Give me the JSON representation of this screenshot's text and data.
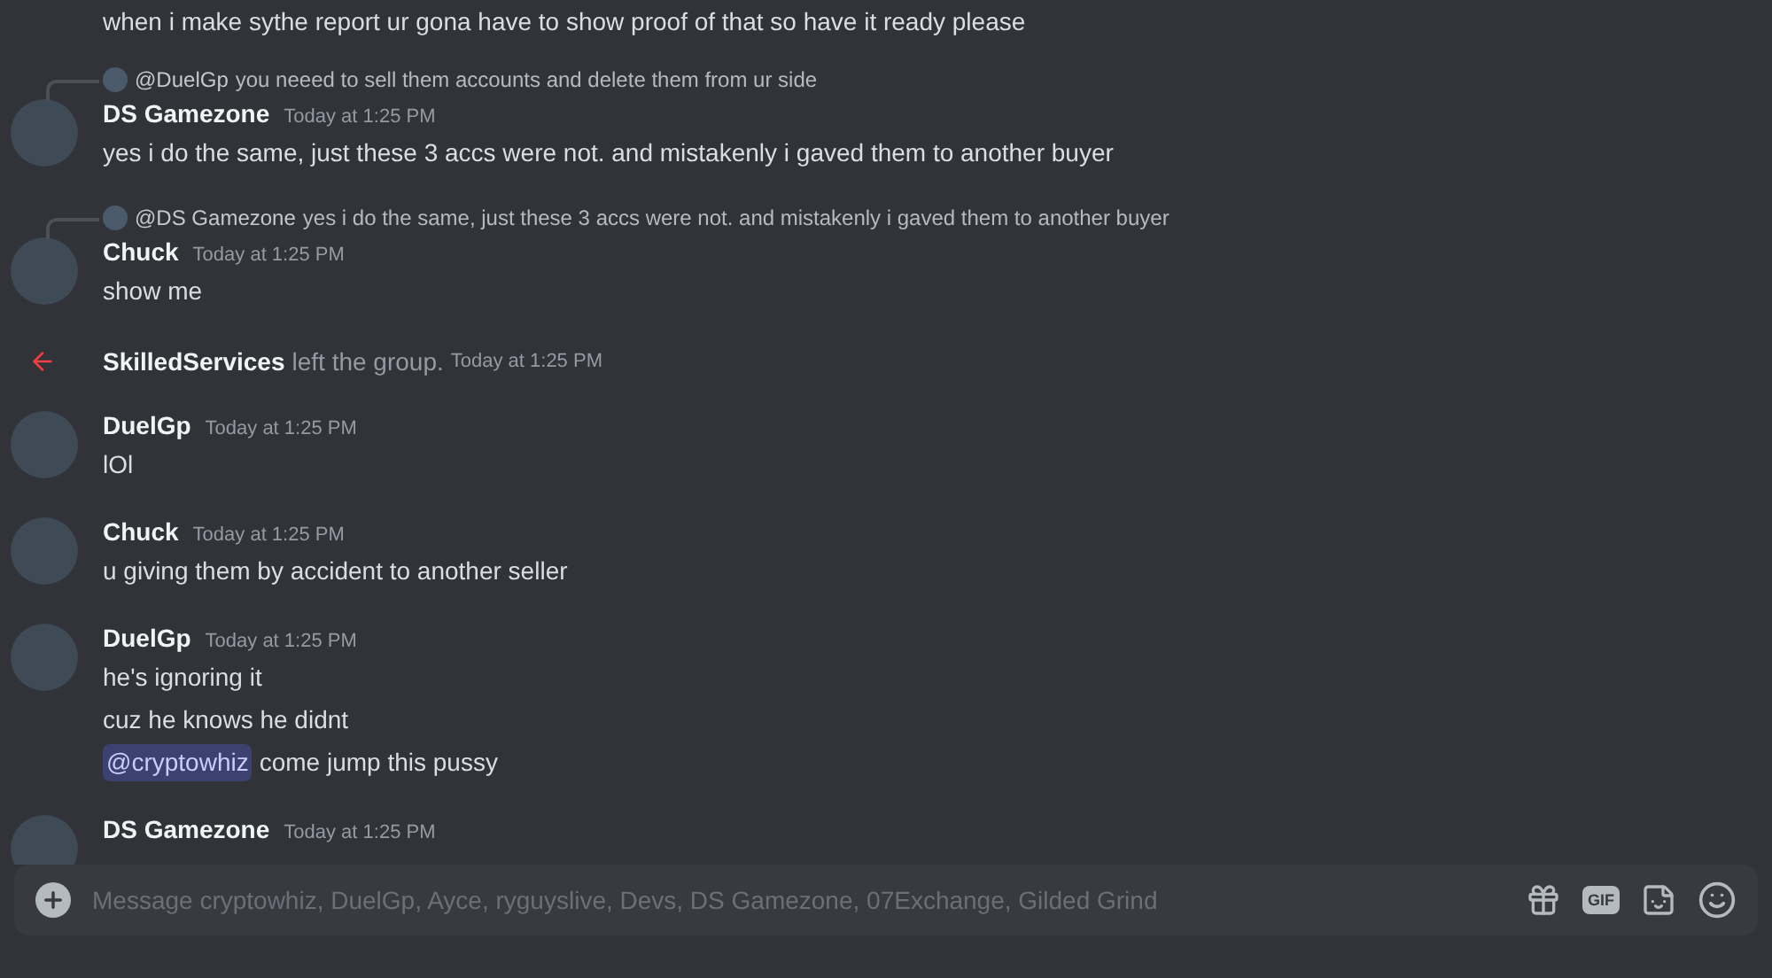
{
  "messages": [
    {
      "kind": "continuation",
      "lines": [
        {
          "text": "when i make sythe report ur gona have to show proof of that so have it ready please"
        }
      ]
    },
    {
      "kind": "message",
      "reply": {
        "author": "@DuelGp",
        "text": "you neeed to sell them accounts and delete them from ur side"
      },
      "author": "DS Gamezone",
      "time": "Today at 1:25 PM",
      "lines": [
        {
          "text": "yes i do the same, just these 3 accs were not. and mistakenly i gaved them to another buyer"
        }
      ]
    },
    {
      "kind": "message",
      "reply": {
        "author": "@DS Gamezone",
        "text": "yes i do the same, just these 3 accs were not. and mistakenly i gaved them to another buyer"
      },
      "author": "Chuck",
      "time": "Today at 1:25 PM",
      "lines": [
        {
          "text": "show me"
        }
      ]
    },
    {
      "kind": "system",
      "author": "SkilledServices",
      "text": "left the group.",
      "time": "Today at 1:25 PM"
    },
    {
      "kind": "message",
      "author": "DuelGp",
      "time": "Today at 1:25 PM",
      "lines": [
        {
          "text": "lOl"
        }
      ]
    },
    {
      "kind": "message",
      "author": "Chuck",
      "time": "Today at 1:25 PM",
      "lines": [
        {
          "text": "u giving them by accident to another seller"
        }
      ]
    },
    {
      "kind": "message",
      "author": "DuelGp",
      "time": "Today at 1:25 PM",
      "lines": [
        {
          "text": "he's ignoring it"
        },
        {
          "text": "cuz he knows he didnt"
        },
        {
          "mention": "@cryptowhiz",
          "text": "come jump this pussy"
        }
      ]
    },
    {
      "kind": "message",
      "author": "DS Gamezone",
      "time": "Today at 1:25 PM"
    }
  ],
  "composer": {
    "placeholder": "Message cryptowhiz, DuelGp, Ayce, ryguyslive, Devs, DS Gamezone, 07Exchange, Gilded Grind",
    "gif_label": "GIF"
  }
}
